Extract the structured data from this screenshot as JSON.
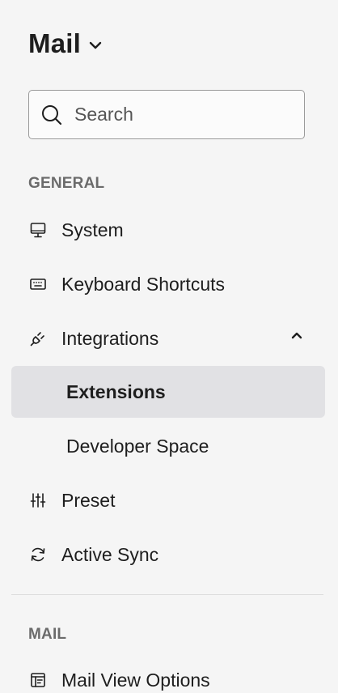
{
  "header": {
    "title": "Mail"
  },
  "search": {
    "placeholder": "Search",
    "value": ""
  },
  "sections": {
    "general": "GENERAL",
    "mail": "MAIL"
  },
  "nav": {
    "system": "System",
    "keyboard_shortcuts": "Keyboard Shortcuts",
    "integrations": "Integrations",
    "extensions": "Extensions",
    "developer_space": "Developer Space",
    "preset": "Preset",
    "active_sync": "Active Sync",
    "mail_view_options": "Mail View Options"
  },
  "state": {
    "selected": "extensions",
    "integrations_expanded": true
  },
  "colors": {
    "background": "#f5f5f5",
    "selected_bg": "#e1e1e4",
    "section_label": "#6b6b6b"
  },
  "icons": {
    "title_dropdown": "chevron-down-icon",
    "search": "search-icon",
    "system": "monitor-icon",
    "keyboard_shortcuts": "keyboard-icon",
    "integrations": "plug-icon",
    "integrations_toggle": "chevron-up-icon",
    "preset": "sliders-icon",
    "active_sync": "sync-icon",
    "mail_view_options": "layout-icon"
  }
}
